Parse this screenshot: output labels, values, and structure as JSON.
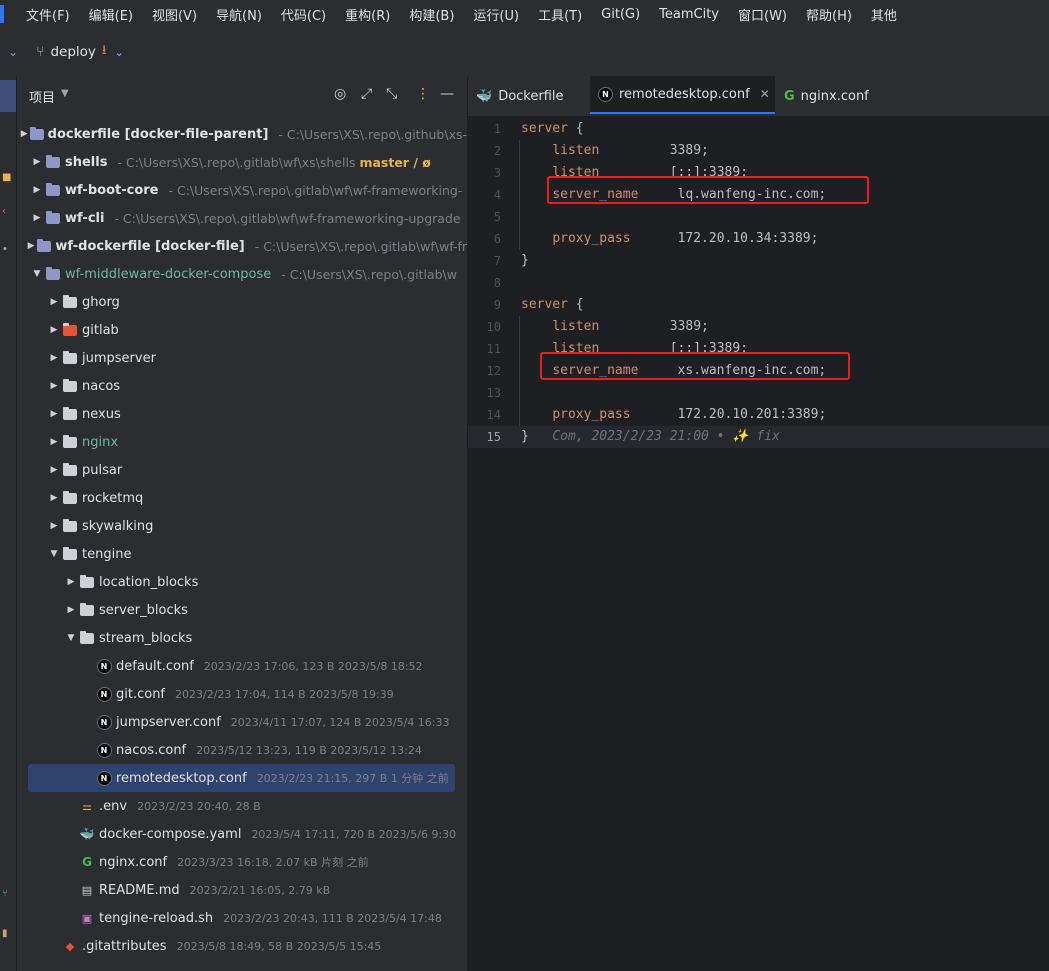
{
  "menubar": {
    "items": [
      "文件(F)",
      "编辑(E)",
      "视图(V)",
      "导航(N)",
      "代码(C)",
      "重构(R)",
      "构建(B)",
      "运行(U)",
      "工具(T)",
      "Git(G)",
      "TeamCity",
      "窗口(W)",
      "帮助(H)",
      "其他"
    ]
  },
  "toolbar": {
    "branch": "deploy"
  },
  "project": {
    "title": "项目",
    "tree": [
      {
        "depth": 0,
        "toggle": "collapsed",
        "icon": "module-folder-icon",
        "name": "dockerfile",
        "tag": "[docker-file-parent]",
        "path": "C:\\Users\\XS\\.repo\\.github\\xs-"
      },
      {
        "depth": 0,
        "toggle": "collapsed",
        "icon": "module-folder-icon",
        "name": "shells",
        "path": "C:\\Users\\XS\\.repo\\.gitlab\\wf\\xs\\shells",
        "branch": "master / ø"
      },
      {
        "depth": 0,
        "toggle": "collapsed",
        "icon": "module-folder-icon",
        "name": "wf-boot-core",
        "path": "C:\\Users\\XS\\.repo\\.gitlab\\wf\\wf-frameworking-"
      },
      {
        "depth": 0,
        "toggle": "collapsed",
        "icon": "module-folder-icon",
        "name": "wf-cli",
        "path": "C:\\Users\\XS\\.repo\\.gitlab\\wf\\wf-frameworking-upgrade"
      },
      {
        "depth": 0,
        "toggle": "collapsed",
        "icon": "module-folder-icon",
        "name": "wf-dockerfile",
        "tag": "[docker-file]",
        "path": "C:\\Users\\XS\\.repo\\.gitlab\\wf\\wf-fr"
      },
      {
        "depth": 0,
        "toggle": "expanded",
        "icon": "module-folder-icon",
        "name": "wf-middleware-docker-compose",
        "modified": true,
        "path": "C:\\Users\\XS\\.repo\\.gitlab\\w"
      },
      {
        "depth": 1,
        "toggle": "collapsed",
        "icon": "folder-icon",
        "name": "ghorg"
      },
      {
        "depth": 1,
        "toggle": "collapsed",
        "icon": "gitlab-folder-icon",
        "name": "gitlab"
      },
      {
        "depth": 1,
        "toggle": "collapsed",
        "icon": "folder-icon",
        "name": "jumpserver"
      },
      {
        "depth": 1,
        "toggle": "collapsed",
        "icon": "folder-icon",
        "name": "nacos"
      },
      {
        "depth": 1,
        "toggle": "collapsed",
        "icon": "folder-icon",
        "name": "nexus"
      },
      {
        "depth": 1,
        "toggle": "collapsed",
        "icon": "folder-icon",
        "name": "nginx",
        "modified": true
      },
      {
        "depth": 1,
        "toggle": "collapsed",
        "icon": "folder-icon",
        "name": "pulsar"
      },
      {
        "depth": 1,
        "toggle": "collapsed",
        "icon": "folder-icon",
        "name": "rocketmq"
      },
      {
        "depth": 1,
        "toggle": "collapsed",
        "icon": "folder-icon",
        "name": "skywalking"
      },
      {
        "depth": 1,
        "toggle": "expanded",
        "icon": "folder-icon",
        "name": "tengine"
      },
      {
        "depth": 2,
        "toggle": "collapsed",
        "icon": "folder-icon",
        "name": "location_blocks"
      },
      {
        "depth": 2,
        "toggle": "collapsed",
        "icon": "folder-icon",
        "name": "server_blocks"
      },
      {
        "depth": 2,
        "toggle": "expanded",
        "icon": "folder-icon",
        "name": "stream_blocks"
      },
      {
        "depth": 3,
        "icon": "nginx-file-icon",
        "name": "default.conf",
        "meta": "2023/2/23 17:06, 123 B 2023/5/8 18:52"
      },
      {
        "depth": 3,
        "icon": "nginx-file-icon",
        "name": "git.conf",
        "meta": "2023/2/23 17:04, 114 B 2023/5/8 19:39"
      },
      {
        "depth": 3,
        "icon": "nginx-file-icon",
        "name": "jumpserver.conf",
        "meta": "2023/4/11 17:07, 124 B 2023/5/4 16:33"
      },
      {
        "depth": 3,
        "icon": "nginx-file-icon",
        "name": "nacos.conf",
        "meta": "2023/5/12 13:23, 119 B 2023/5/12 13:24"
      },
      {
        "depth": 3,
        "icon": "nginx-file-icon",
        "name": "remotedesktop.conf",
        "meta": "2023/2/23 21:15, 297 B 1 分钟 之前",
        "selected": true
      },
      {
        "depth": 2,
        "icon": "env-file-icon",
        "name": ".env",
        "meta": "2023/2/23 20:40, 28 B"
      },
      {
        "depth": 2,
        "icon": "docker-icon",
        "name": "docker-compose.yaml",
        "meta": "2023/5/4 17:11, 720 B 2023/5/6 9:30"
      },
      {
        "depth": 2,
        "icon": "nginx-g-icon",
        "name": "nginx.conf",
        "meta": "2023/3/23 16:18, 2.07 kB 片刻 之前"
      },
      {
        "depth": 2,
        "icon": "markdown-icon",
        "name": "README.md",
        "meta": "2023/2/21 16:05, 2.79 kB"
      },
      {
        "depth": 2,
        "icon": "shell-script-icon",
        "name": "tengine-reload.sh",
        "meta": "2023/2/23 20:43, 111 B 2023/5/4 17:48"
      },
      {
        "depth": 1,
        "icon": "git-icon",
        "name": ".gitattributes",
        "meta": "2023/5/8 18:49, 58 B 2023/5/5 15:45"
      }
    ]
  },
  "editor": {
    "tabs": [
      {
        "label": "Dockerfile",
        "icon": "docker-icon"
      },
      {
        "label": "remotedesktop.conf",
        "icon": "nginx-file-icon",
        "active": true
      },
      {
        "label": "nginx.conf",
        "icon": "nginx-g-icon"
      }
    ],
    "lines": [
      {
        "n": "1",
        "kw": "server",
        "rest": " {"
      },
      {
        "n": "2",
        "indent": true,
        "kw": "listen",
        "pad": "         ",
        "val": "3389;"
      },
      {
        "n": "3",
        "indent": true,
        "kw": "listen",
        "pad": "         ",
        "val": "[::]:3389;"
      },
      {
        "n": "4",
        "indent": true,
        "kw": "server_name",
        "pad": "     ",
        "val": "lq.wanfeng-inc.com;"
      },
      {
        "n": "5"
      },
      {
        "n": "6",
        "indent": true,
        "kw": "proxy_pass",
        "pad": "      ",
        "val": "172.20.10.34:3389;"
      },
      {
        "n": "7",
        "rest": "}"
      },
      {
        "n": "8"
      },
      {
        "n": "9",
        "kw": "server",
        "rest": " {"
      },
      {
        "n": "10",
        "indent": true,
        "kw": "listen",
        "pad": "         ",
        "val": "3389;"
      },
      {
        "n": "11",
        "indent": true,
        "kw": "listen",
        "pad": "         ",
        "val": "[::]:3389;"
      },
      {
        "n": "12",
        "indent": true,
        "kw": "server_name",
        "pad": "     ",
        "val": "xs.wanfeng-inc.com;"
      },
      {
        "n": "13"
      },
      {
        "n": "14",
        "indent": true,
        "kw": "proxy_pass",
        "pad": "      ",
        "val": "172.20.10.201:3389;"
      },
      {
        "n": "15",
        "rest": "}",
        "blame": "   Com, 2023/2/23 21:00 • ✨ fix",
        "current": true
      }
    ]
  },
  "colors": {
    "keyword": "#cf8e6d",
    "modified": "#72b7a5",
    "branch": "#e8b44a",
    "accent": "#3574f0",
    "highlight_box": "#e62020"
  }
}
